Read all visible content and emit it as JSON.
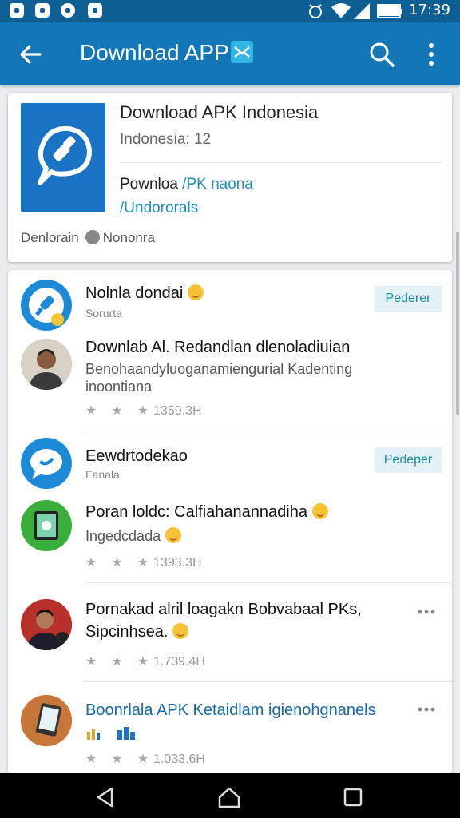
{
  "status_bar": {
    "time": "17:39"
  },
  "app_bar": {
    "title": "Download APP"
  },
  "hero": {
    "title": "Download APK Indonesia",
    "subtitle": "Indonesia: 12",
    "line1_a": "Pownloa ",
    "line1_b": "/PK naona",
    "line2": "/Undororals",
    "footer_left": "Denlorain",
    "footer_right": "Nononra"
  },
  "items": [
    {
      "name": "Nolnla dondai",
      "small": "Sorurta",
      "button": "Pederer",
      "icon": "chat-bubble-icon"
    },
    {
      "name": "Downlab Al. Redandlan dlenoladiuian",
      "sub": "Benohaandyluoganamiengurial Kadenting",
      "sub2": "inoontiana",
      "rating": "1359.3H",
      "avatar": "person-avatar"
    },
    {
      "name": "Eewdrtodekao",
      "small": "Fanala",
      "button": "Pedeper",
      "icon": "chat-bubble-icon"
    },
    {
      "name": "Poran loldc: Calfiahanannadiha",
      "sub": "Ingedcdada",
      "rating": "1393.3H",
      "icon": "phone-icon"
    },
    {
      "name": "Pornakad alril loagakn Bobvabaal PKs,",
      "sub": "Sipcinhsea.",
      "rating": "1.739.4H",
      "avatar": "person-avatar"
    },
    {
      "name": "Boonrlala APK Ketaidlam igienohgnanels",
      "rating": "1.033.6H",
      "icon": "tablet-icon"
    }
  ]
}
